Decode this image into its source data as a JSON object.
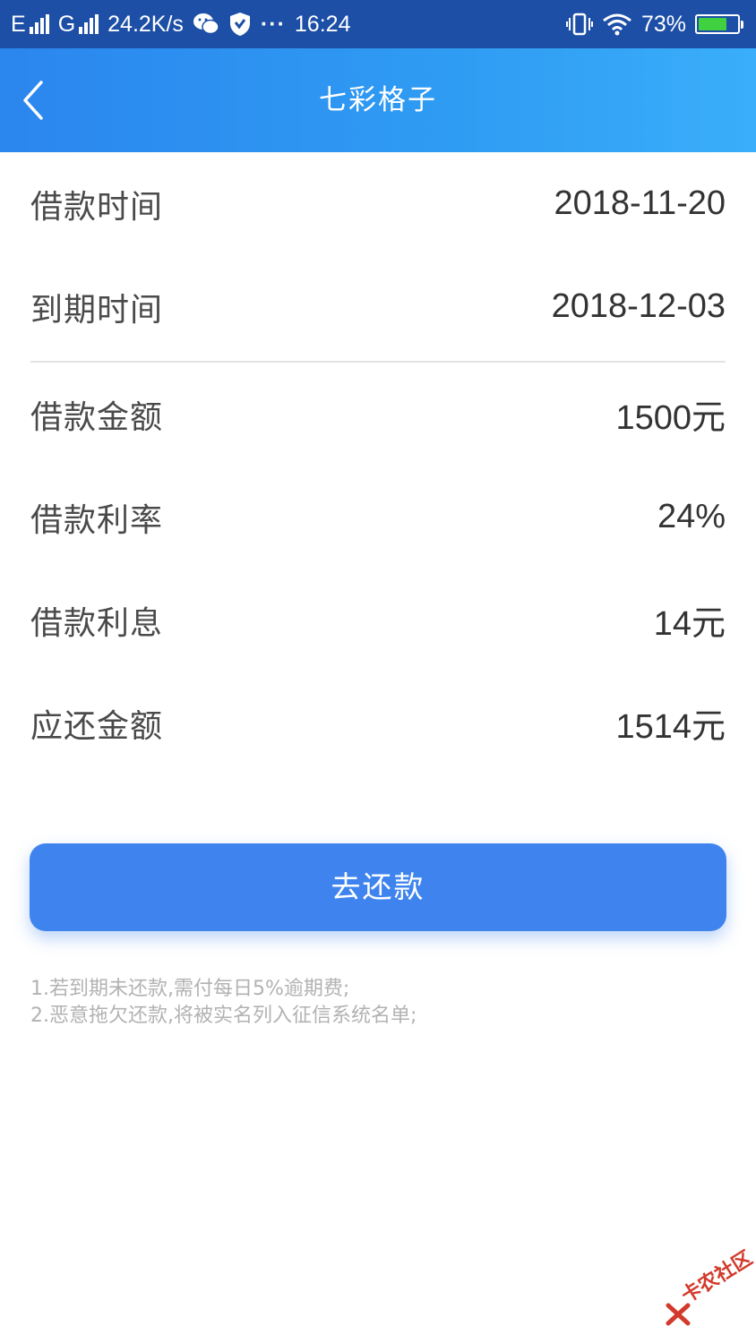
{
  "status_bar": {
    "network1": "E",
    "network2": "G",
    "speed": "24.2K/s",
    "time": "16:24",
    "battery": "73%",
    "battery_level": 0.73,
    "icons": [
      "signal-icon",
      "wechat-icon",
      "shield-icon",
      "more-dots-icon",
      "vibrate-icon",
      "wifi-icon",
      "battery-icon"
    ]
  },
  "header": {
    "title": "七彩格子",
    "back_icon": "chevron-left-icon"
  },
  "loan": {
    "dates": [
      {
        "label": "借款时间",
        "value": "2018-11-20"
      },
      {
        "label": "到期时间",
        "value": "2018-12-03"
      }
    ],
    "details": [
      {
        "label": "借款金额",
        "value": "1500元"
      },
      {
        "label": "借款利率",
        "value": "24%"
      },
      {
        "label": "借款利息",
        "value": "14元"
      },
      {
        "label": "应还金额",
        "value": "1514元"
      }
    ]
  },
  "repay_button": {
    "label": "去还款"
  },
  "notes": [
    "1.若到期未还款,需付每日5%逾期费;",
    "2.恶意拖欠还款,将被实名列入征信系统名单;"
  ],
  "watermark": {
    "text": "卡农社区"
  },
  "colors": {
    "status_bar": "#1d4fa6",
    "header_start": "#2b86ee",
    "header_end": "#3aaefa",
    "button": "#3f84ee",
    "note_text": "#b2b2b2",
    "watermark": "#d23a2c"
  }
}
